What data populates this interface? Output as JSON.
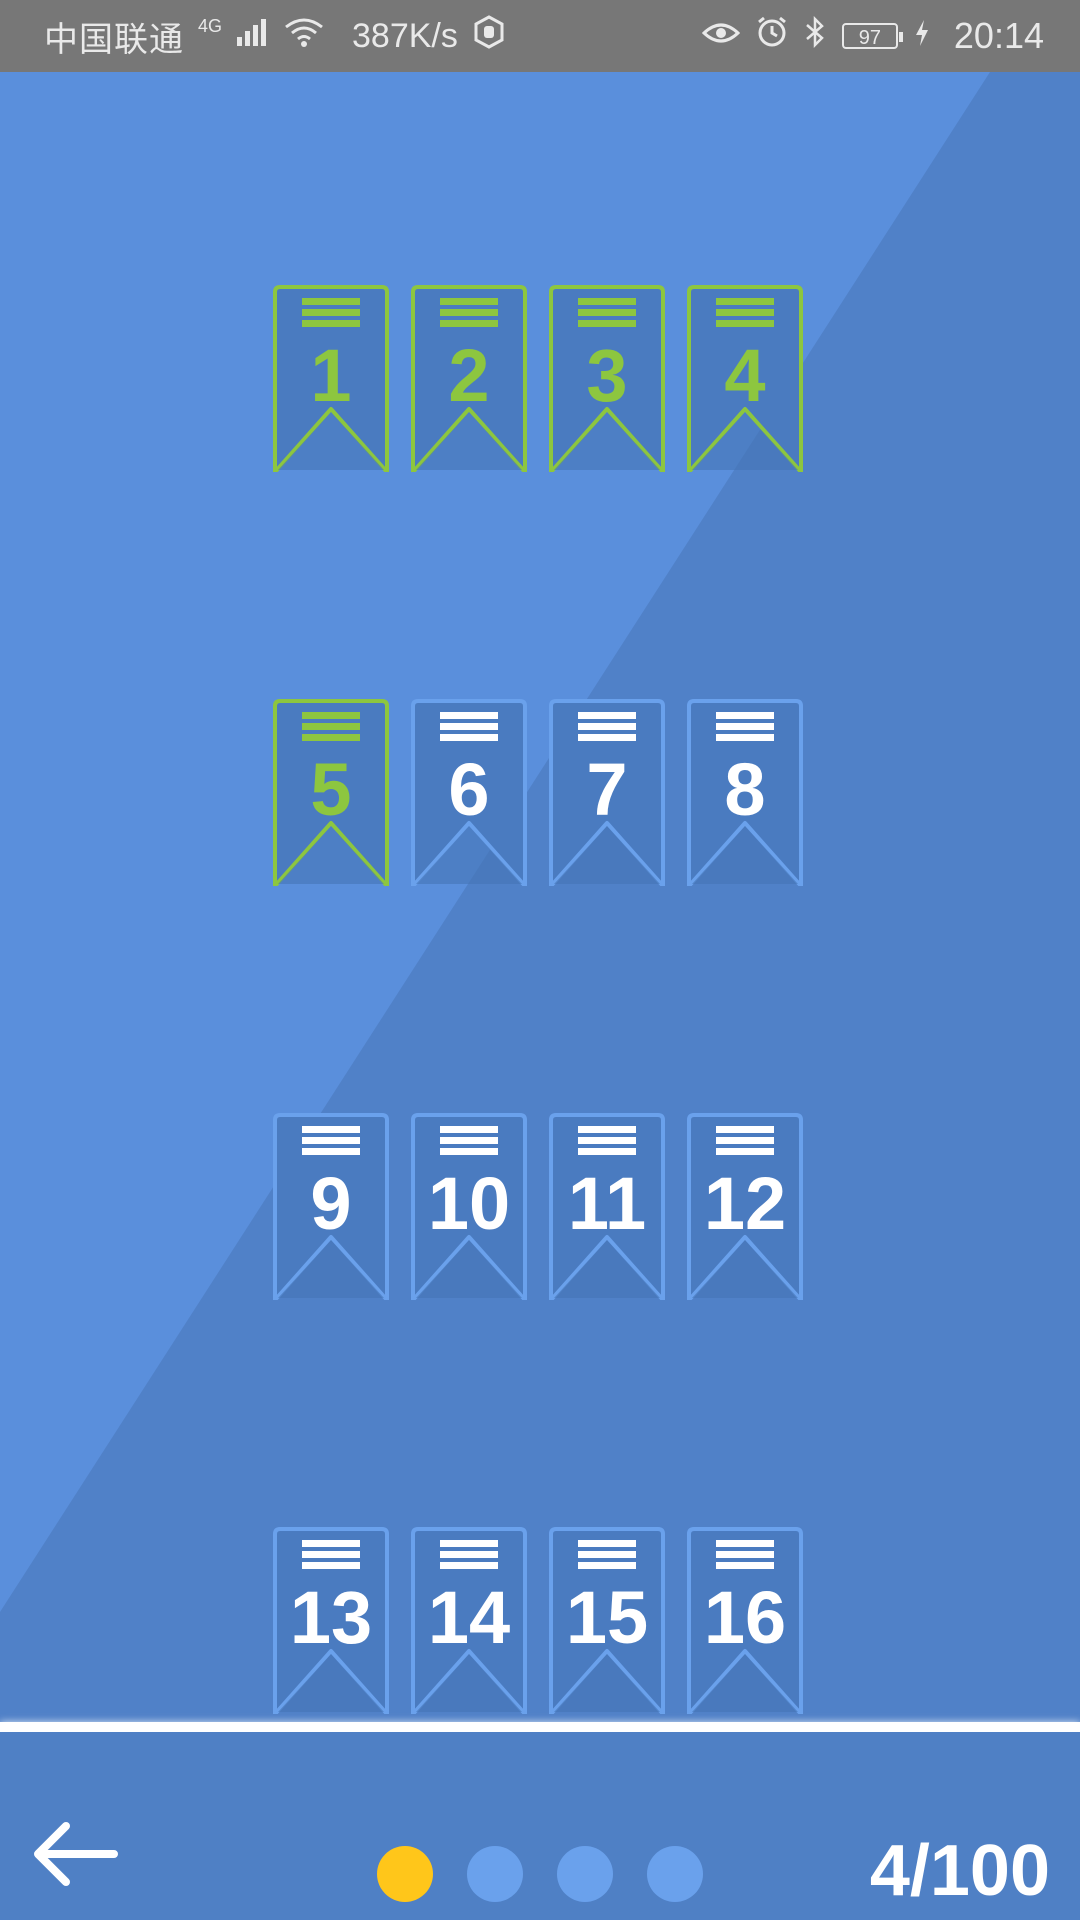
{
  "status_bar": {
    "carrier": "中国联通",
    "network": "4G",
    "speed": "387K/s",
    "battery": "97",
    "time": "20:14"
  },
  "levels": [
    {
      "number": "1",
      "completed": true
    },
    {
      "number": "2",
      "completed": true
    },
    {
      "number": "3",
      "completed": true
    },
    {
      "number": "4",
      "completed": true
    },
    {
      "number": "5",
      "completed": true
    },
    {
      "number": "6",
      "completed": false
    },
    {
      "number": "7",
      "completed": false
    },
    {
      "number": "8",
      "completed": false
    },
    {
      "number": "9",
      "completed": false
    },
    {
      "number": "10",
      "completed": false
    },
    {
      "number": "11",
      "completed": false
    },
    {
      "number": "12",
      "completed": false
    },
    {
      "number": "13",
      "completed": false
    },
    {
      "number": "14",
      "completed": false
    },
    {
      "number": "15",
      "completed": false
    },
    {
      "number": "16",
      "completed": false
    }
  ],
  "pager": {
    "page_count": 4,
    "active_page": 1
  },
  "progress_text": "4/100",
  "colors": {
    "completed": "#8dc63f",
    "locked_border": "#6aa1ec",
    "badge_fill": "#4a7bc0",
    "active_dot": "#ffc61a",
    "inactive_dot": "#6aa1ec"
  }
}
